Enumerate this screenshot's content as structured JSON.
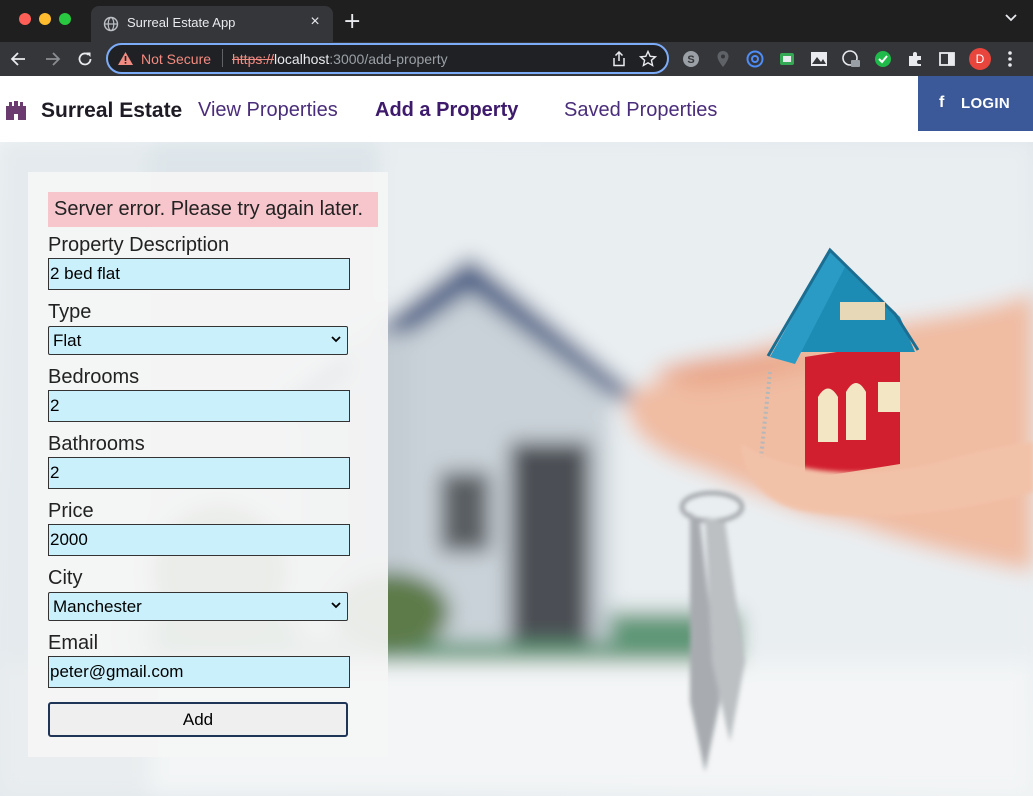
{
  "browser": {
    "tab_title": "Surreal Estate App",
    "tab_close": "×",
    "new_tab": "+",
    "security_label": "Not Secure",
    "url_scheme": "https://",
    "url_host": "localhost",
    "url_path": ":3000/add-property",
    "profile_initial": "D"
  },
  "navbar": {
    "brand": "Surreal Estate",
    "links": [
      {
        "label": "View Properties"
      },
      {
        "label": "Add a Property"
      },
      {
        "label": "Saved Properties"
      }
    ],
    "login_icon": "f",
    "login_label": "LOGIN",
    "login_color": "#3b5998"
  },
  "form": {
    "error": "Server error. Please try again later.",
    "fields": {
      "description": {
        "label": "Property Description",
        "value": "2 bed flat"
      },
      "type": {
        "label": "Type",
        "value": "Flat"
      },
      "bedrooms": {
        "label": "Bedrooms",
        "value": "2"
      },
      "bathrooms": {
        "label": "Bathrooms",
        "value": "2"
      },
      "price": {
        "label": "Price",
        "value": "2000"
      },
      "city": {
        "label": "City",
        "value": "Manchester"
      },
      "email": {
        "label": "Email",
        "value": "peter@gmail.com"
      }
    },
    "submit_label": "Add",
    "input_bg": "#caf0fb",
    "error_bg": "#f7c6cc"
  },
  "icons": {
    "tab": "globe-icon",
    "brand": "castle-icon",
    "warning": "warning-icon",
    "login": "facebook-icon"
  }
}
